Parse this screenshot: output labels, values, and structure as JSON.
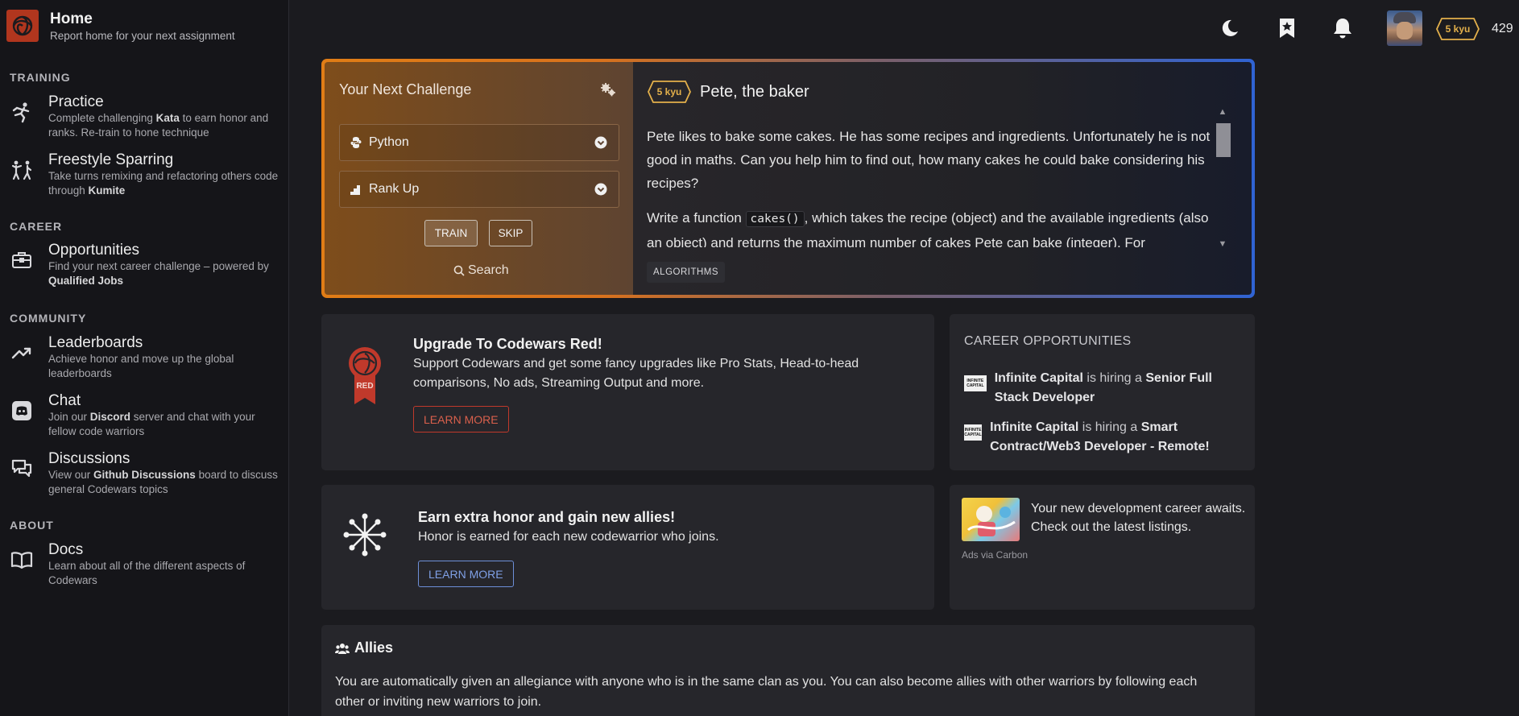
{
  "sidebar": {
    "home": {
      "title": "Home",
      "subtitle": "Report home for your next assignment"
    },
    "sections": {
      "training": "TRAINING",
      "career": "CAREER",
      "community": "COMMUNITY",
      "about": "ABOUT"
    },
    "items": [
      {
        "title": "Practice",
        "desc_a": "Complete challenging ",
        "desc_b": "Kata",
        "desc_c": " to earn honor and ranks. Re-train to hone technique",
        "icon": "kata-icon"
      },
      {
        "title": "Freestyle Sparring",
        "desc_a": "Take turns remixing and refactoring others code through ",
        "desc_b": "Kumite",
        "desc_c": "",
        "icon": "kumite-icon"
      },
      {
        "title": "Opportunities",
        "desc_a": "Find your next career challenge – powered by ",
        "desc_b": "Qualified Jobs",
        "desc_c": "",
        "icon": "briefcase-icon"
      },
      {
        "title": "Leaderboards",
        "desc_a": "Achieve honor and move up the global leaderboards",
        "desc_b": "",
        "desc_c": "",
        "icon": "trending-up-icon"
      },
      {
        "title": "Chat",
        "desc_a": "Join our ",
        "desc_b": "Discord",
        "desc_c": " server and chat with your fellow code warriors",
        "icon": "discord-icon"
      },
      {
        "title": "Discussions",
        "desc_a": "View our ",
        "desc_b": "Github Discussions",
        "desc_c": " board to discuss general Codewars topics",
        "icon": "chat-bubbles-icon"
      },
      {
        "title": "Docs",
        "desc_a": "Learn about all of the different aspects of Codewars",
        "desc_b": "",
        "desc_c": "",
        "icon": "book-icon"
      }
    ]
  },
  "topbar": {
    "rank": "5 kyu",
    "honor": "429"
  },
  "challenge": {
    "heading": "Your Next Challenge",
    "language": "Python",
    "strategy": "Rank Up",
    "train_label": "TRAIN",
    "skip_label": "SKIP",
    "search_label": "Search",
    "kata": {
      "rank": "5 kyu",
      "name": "Pete, the baker",
      "p1": "Pete likes to bake some cakes. He has some recipes and ingredients. Unfortunately he is not good in maths. Can you help him to find out, how many cakes he could bake considering his recipes?",
      "p2_a": "Write a function ",
      "p2_code": "cakes()",
      "p2_b": ", which takes the recipe (object) and the available ingredients (also an object) and returns the maximum number of cakes Pete can bake (integer). For",
      "tag": "ALGORITHMS"
    }
  },
  "upgrade": {
    "title": "Upgrade To Codewars Red!",
    "text": "Support Codewars and get some fancy upgrades like Pro Stats, Head-to-head comparisons, No ads, Streaming Output and more.",
    "badge": "RED",
    "button": "LEARN MORE"
  },
  "career": {
    "heading": "CAREER OPPORTUNITIES",
    "jobs": [
      {
        "company": "Infinite Capital",
        "middle": " is hiring a ",
        "role": "Senior Full Stack Developer",
        "logo_text": "INFINITE CAPITAL"
      },
      {
        "company": "Infinite Capital",
        "middle": " is hiring a ",
        "role": "Smart Contract/Web3 Developer - Remote!",
        "logo_text": "INFINITE CAPITAL"
      }
    ]
  },
  "honor_card": {
    "title": "Earn extra honor and gain new allies!",
    "text": "Honor is earned for each new codewarrior who joins.",
    "button": "LEARN MORE"
  },
  "ad": {
    "text": "Your new development career awaits. Check out the latest listings.",
    "via": "Ads via Carbon"
  },
  "allies": {
    "title": "Allies",
    "text": "You are automatically given an allegiance with anyone who is in the same clan as you. You can also become allies with other warriors by following each other or inviting new warriors to join."
  },
  "colors": {
    "accent_orange": "#e07d16",
    "accent_blue": "#3063d3",
    "rank_yellow": "#e3b04b",
    "red": "#b1361e",
    "link_blue": "#6d8fd8"
  }
}
